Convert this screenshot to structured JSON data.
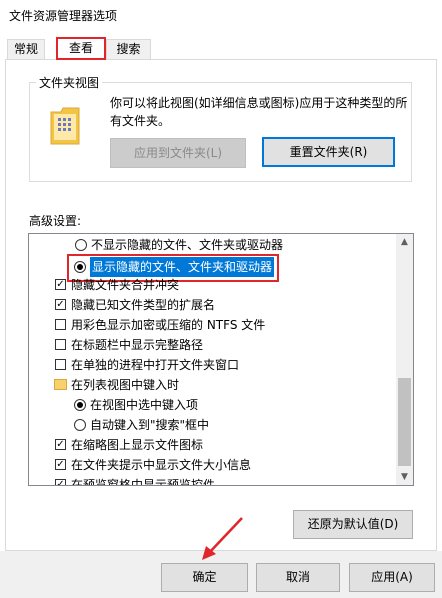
{
  "window": {
    "title": "文件资源管理器选项"
  },
  "tabs": [
    {
      "label": "常规"
    },
    {
      "label": "查看"
    },
    {
      "label": "搜索"
    }
  ],
  "folder_views": {
    "title": "文件夹视图",
    "description": "你可以将此视图(如详细信息或图标)应用于这种类型的所有文件夹。",
    "apply_button": "应用到文件夹(L)",
    "reset_button": "重置文件夹(R)"
  },
  "advanced": {
    "label": "高级设置:",
    "items": [
      {
        "type": "radio",
        "checked": false,
        "label": "不显示隐藏的文件、文件夹或驱动器"
      },
      {
        "type": "radio",
        "checked": true,
        "label": "显示隐藏的文件、文件夹和驱动器"
      },
      {
        "type": "checkbox",
        "checked": true,
        "label": "隐藏文件夹合并冲突"
      },
      {
        "type": "checkbox",
        "checked": true,
        "label": "隐藏已知文件类型的扩展名"
      },
      {
        "type": "checkbox",
        "checked": false,
        "label": "用彩色显示加密或压缩的 NTFS 文件"
      },
      {
        "type": "checkbox",
        "checked": false,
        "label": "在标题栏中显示完整路径"
      },
      {
        "type": "checkbox",
        "checked": false,
        "label": "在单独的进程中打开文件夹窗口"
      },
      {
        "type": "folder",
        "label": "在列表视图中键入时"
      },
      {
        "type": "radio",
        "checked": true,
        "label": "在视图中选中键入项"
      },
      {
        "type": "radio",
        "checked": false,
        "label": "自动键入到\"搜索\"框中"
      },
      {
        "type": "checkbox",
        "checked": true,
        "label": "在缩略图上显示文件图标"
      },
      {
        "type": "checkbox",
        "checked": true,
        "label": "在文件夹提示中显示文件大小信息"
      },
      {
        "type": "checkbox",
        "checked": true,
        "label": "在预览窗格中显示预览控件"
      }
    ],
    "restore_button": "还原为默认值(D)"
  },
  "footer": {
    "ok": "确定",
    "cancel": "取消",
    "apply": "应用(A)"
  },
  "colors": {
    "highlight": "#0078d7",
    "annotation": "#e0252b"
  }
}
